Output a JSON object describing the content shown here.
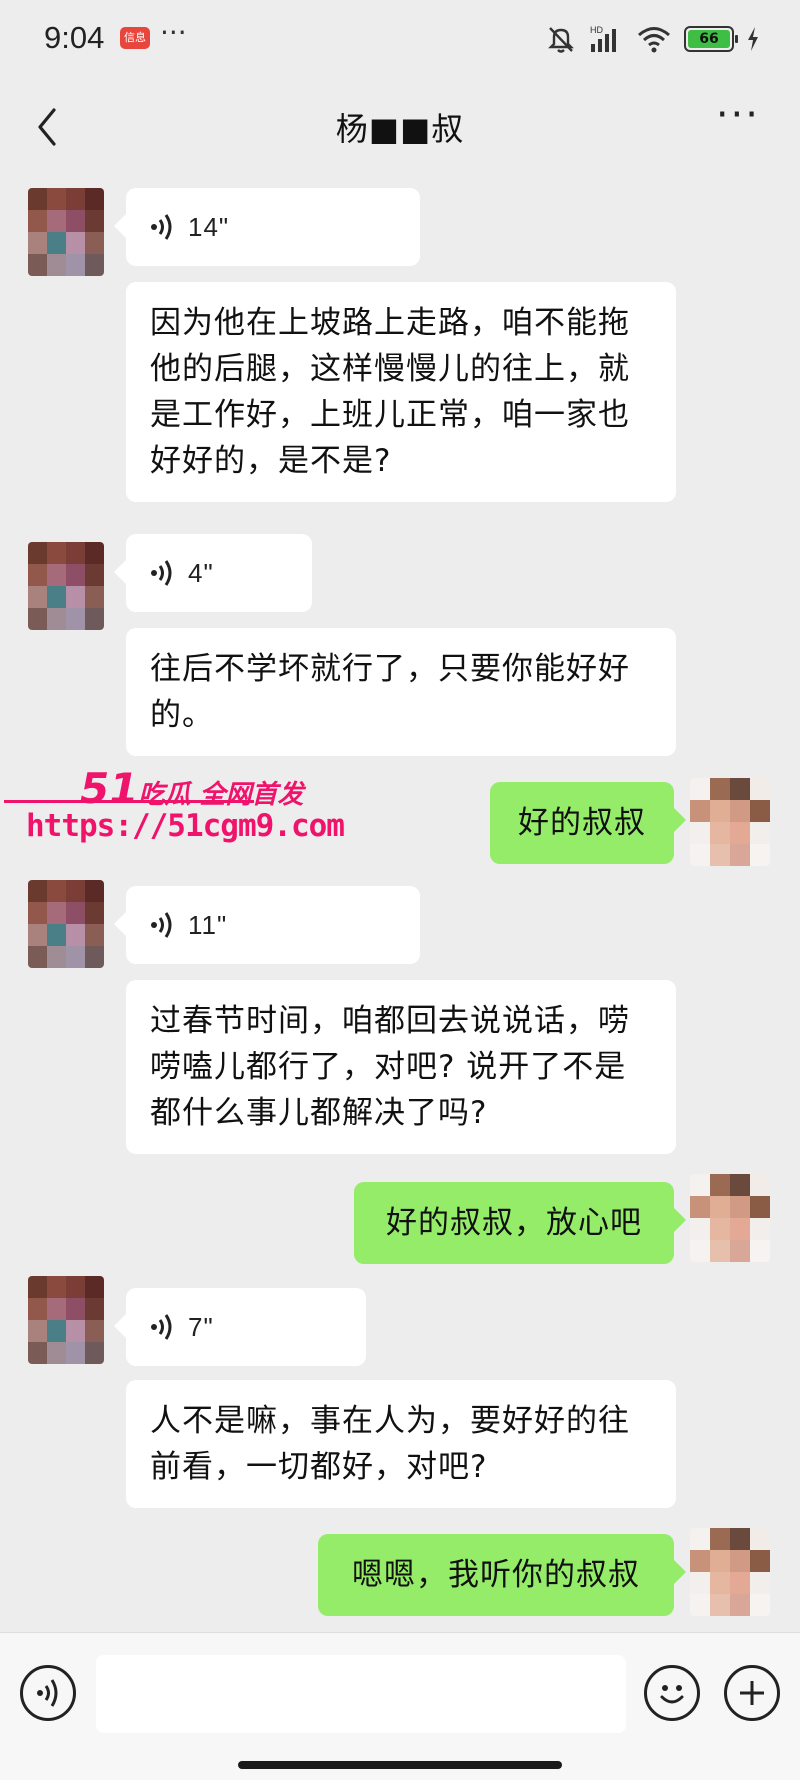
{
  "status": {
    "time": "9:04",
    "app_badge": "信息",
    "more": "···",
    "battery": "66"
  },
  "header": {
    "title": "杨■■叔",
    "more": "···"
  },
  "messages": [
    {
      "side": "left",
      "kind": "voice",
      "duration": "14\""
    },
    {
      "side": "left",
      "kind": "text",
      "text": "因为他在上坡路上走路，咱不能拖他的后腿，这样慢慢儿的往上，就是工作好，上班儿正常，咱一家也好好的，是不是?"
    },
    {
      "side": "left",
      "kind": "voice",
      "duration": "4\""
    },
    {
      "side": "left",
      "kind": "text",
      "text": "往后不学坏就行了，只要你能好好的。"
    },
    {
      "side": "right",
      "kind": "text",
      "text": "好的叔叔"
    },
    {
      "side": "left",
      "kind": "voice",
      "duration": "11\""
    },
    {
      "side": "left",
      "kind": "text",
      "text": "过春节时间，咱都回去说说话，唠唠嗑儿都行了，对吧? 说开了不是都什么事儿都解决了吗?"
    },
    {
      "side": "right",
      "kind": "text",
      "text": "好的叔叔，放心吧"
    },
    {
      "side": "left",
      "kind": "voice",
      "duration": "7\""
    },
    {
      "side": "left",
      "kind": "text",
      "text": "人不是嘛，事在人为，要好好的往前看，一切都好，对吧?"
    },
    {
      "side": "right",
      "kind": "text",
      "text": "嗯嗯，我听你的叔叔"
    }
  ],
  "watermark": {
    "brand_number": "51",
    "brand_text": "吃瓜 全网首发",
    "url": "https://51cgm9.com"
  },
  "input_bar": {
    "placeholder": ""
  },
  "icons": {
    "back": "chevron-left-icon",
    "more": "more-icon",
    "voice": "voice-icon",
    "emoji": "emoji-icon",
    "plus": "plus-icon"
  },
  "colors": {
    "background": "#ededed",
    "mine_bubble": "#95ec69",
    "other_bubble": "#ffffff",
    "watermark": "#f0136b"
  }
}
